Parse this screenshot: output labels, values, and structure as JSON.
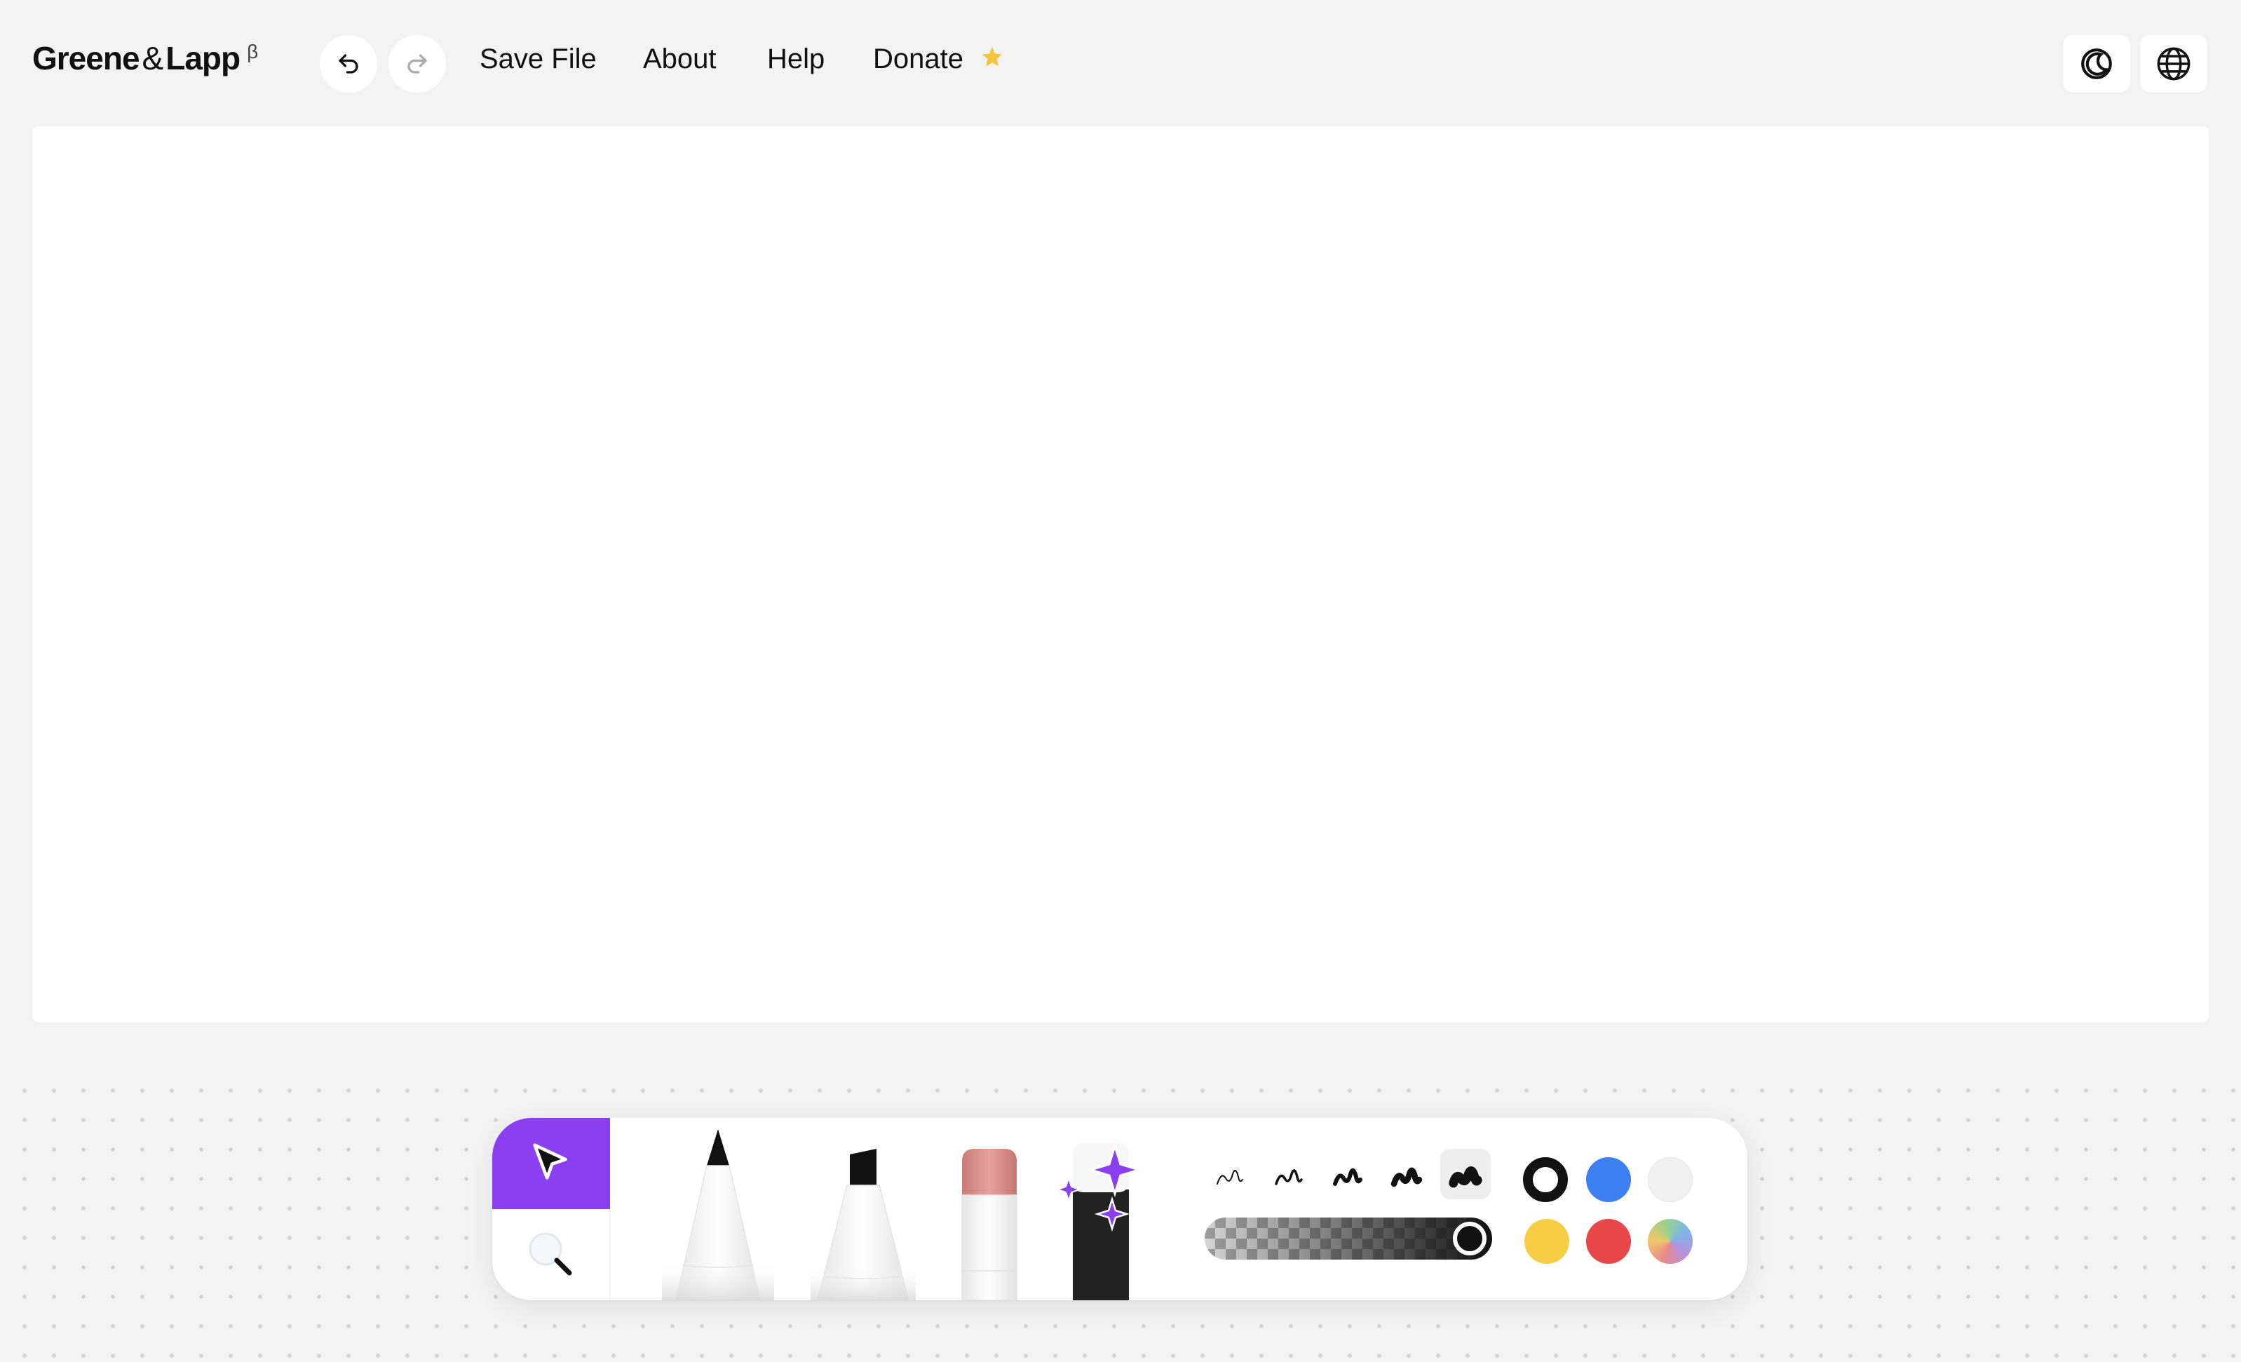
{
  "app": {
    "logo_left": "Greene",
    "logo_amp": "&",
    "logo_right": "Lapp",
    "logo_beta": "β"
  },
  "header": {
    "undo_icon": "undo-icon",
    "redo_icon": "redo-icon",
    "menu": {
      "save_file": "Save File",
      "about": "About",
      "help": "Help",
      "donate": "Donate"
    },
    "donate_star_color": "#f5c542",
    "theme_icon": "moon-icon",
    "language_icon": "globe-icon"
  },
  "toolbar": {
    "tools": [
      "select",
      "zoom",
      "pen",
      "marker",
      "eraser",
      "magic-brush"
    ],
    "active_tool": "select",
    "accent_color": "#8b3ff0",
    "stroke_widths": [
      "extra-thin",
      "thin",
      "medium",
      "thick",
      "extra-thick"
    ],
    "active_stroke": "extra-thick",
    "opacity": 1.0,
    "colors": [
      {
        "name": "black",
        "hex": "#111111",
        "selected": true
      },
      {
        "name": "blue",
        "hex": "#3b7ff0",
        "selected": false
      },
      {
        "name": "white",
        "hex": "#f1f1f1",
        "selected": false
      },
      {
        "name": "yellow",
        "hex": "#f6cd45",
        "selected": false
      },
      {
        "name": "red",
        "hex": "#e8474a",
        "selected": false
      },
      {
        "name": "custom",
        "hex": "rainbow",
        "selected": false
      }
    ]
  }
}
